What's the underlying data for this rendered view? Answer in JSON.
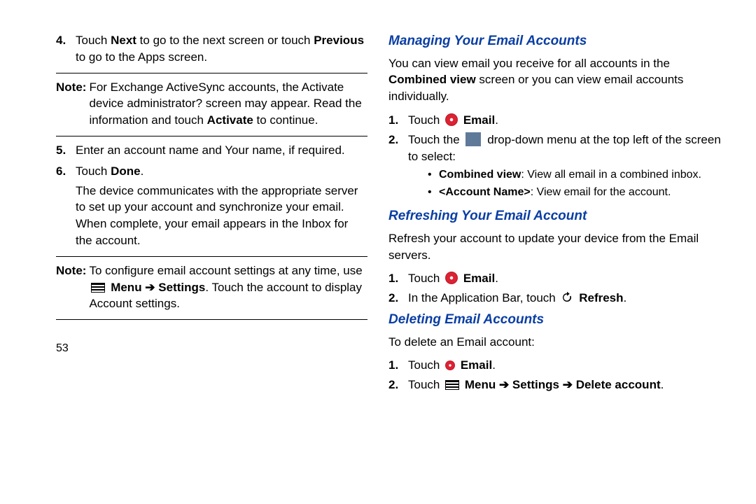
{
  "left": {
    "step4_num": "4.",
    "step4_a": "Touch ",
    "step4_b": "Next",
    "step4_c": " to go to the next screen or touch ",
    "step4_d": "Previous",
    "step4_e": " to go to the Apps screen.",
    "note1_label": "Note:",
    "note1_a": "For Exchange ActiveSync accounts, the Activate device administrator? screen may appear. Read the information and touch ",
    "note1_b": "Activate",
    "note1_c": " to continue.",
    "step5_num": "5.",
    "step5": "Enter an account name and Your name, if required.",
    "step6_num": "6.",
    "step6_a": "Touch ",
    "step6_b": "Done",
    "step6_c": ".",
    "step6_p": "The device communicates with the appropriate server to set up your account and synchronize your email. When complete, your email appears in the Inbox for the account.",
    "note2_label": "Note:",
    "note2_a": "To configure email account settings at any time, use ",
    "note2_menu": "Menu",
    "note2_arrow": " ➔ ",
    "note2_settings": "Settings",
    "note2_b": ". Touch the account to display Account settings.",
    "pagenum": "53"
  },
  "right": {
    "h1": "Managing Your Email Accounts",
    "h1_p_a": "You can view email you receive for all accounts in the ",
    "h1_p_b": "Combined view",
    "h1_p_c": " screen or you can view email accounts individually.",
    "h1_s1_num": "1.",
    "h1_s1_touch": "Touch ",
    "h1_s1_email": "Email",
    "h1_s2_num": "2.",
    "h1_s2_a": "Touch the ",
    "h1_s2_b": " drop-down menu at the top left of the screen to select:",
    "h1_b1_a": "Combined view",
    "h1_b1_b": ": View all email in a combined inbox.",
    "h1_b2_a": "<Account Name>",
    "h1_b2_b": ": View email for the account.",
    "h2": "Refreshing Your Email Account",
    "h2_p": "Refresh your account to update your device from the Email servers.",
    "h2_s1_num": "1.",
    "h2_s1_touch": "Touch ",
    "h2_s1_email": "Email",
    "h2_s2_num": "2.",
    "h2_s2_a": "In the Application Bar, touch ",
    "h2_s2_refresh": "Refresh",
    "h3": "Deleting Email Accounts",
    "h3_p": "To delete an Email account:",
    "h3_s1_num": "1.",
    "h3_s1_touch": "Touch ",
    "h3_s1_email": "Email",
    "h3_s2_num": "2.",
    "h3_s2_touch": "Touch ",
    "h3_s2_menu": "Menu",
    "h3_s2_arrow1": " ➔ ",
    "h3_s2_settings": "Settings",
    "h3_s2_arrow2": " ➔ ",
    "h3_s2_delete": "Delete account",
    "dot": "."
  }
}
